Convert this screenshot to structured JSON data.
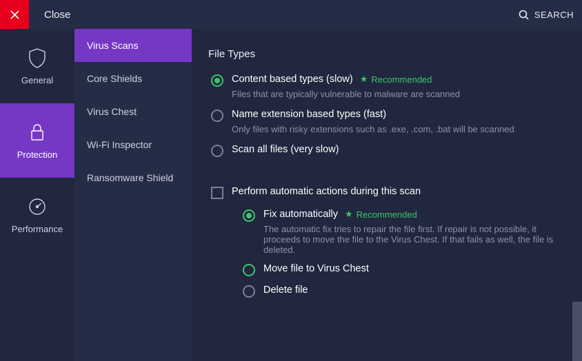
{
  "topbar": {
    "close_label": "Close",
    "search_label": "SEARCH"
  },
  "nav_primary": [
    {
      "label": "General"
    },
    {
      "label": "Protection"
    },
    {
      "label": "Performance"
    }
  ],
  "nav_secondary": [
    {
      "label": "Virus Scans"
    },
    {
      "label": "Core Shields"
    },
    {
      "label": "Virus Chest"
    },
    {
      "label": "Wi-Fi Inspector"
    },
    {
      "label": "Ransomware Shield"
    }
  ],
  "main": {
    "section_title": "File Types",
    "recommended_label": "Recommended",
    "file_types": [
      {
        "label": "Content based types (slow)",
        "desc": "Files that are typically vulnerable to malware are scanned",
        "recommended": true,
        "selected": true
      },
      {
        "label": "Name extension based types (fast)",
        "desc": "Only files with risky extensions such as .exe, .com, .bat will be scanned",
        "recommended": false,
        "selected": false
      },
      {
        "label": "Scan all files (very slow)",
        "desc": "",
        "recommended": false,
        "selected": false
      }
    ],
    "auto_actions": {
      "checkbox_label": "Perform automatic actions during this scan",
      "options": [
        {
          "label": "Fix automatically",
          "desc": "The automatic fix tries to repair the file first. If repair is not possible, it proceeds to move the file to the Virus Chest. If that fails as well, the file is deleted.",
          "recommended": true,
          "selected": true
        },
        {
          "label": "Move file to Virus Chest",
          "desc": "",
          "recommended": false,
          "selected": false,
          "green": true
        },
        {
          "label": "Delete file",
          "desc": "",
          "recommended": false,
          "selected": false
        }
      ]
    }
  }
}
